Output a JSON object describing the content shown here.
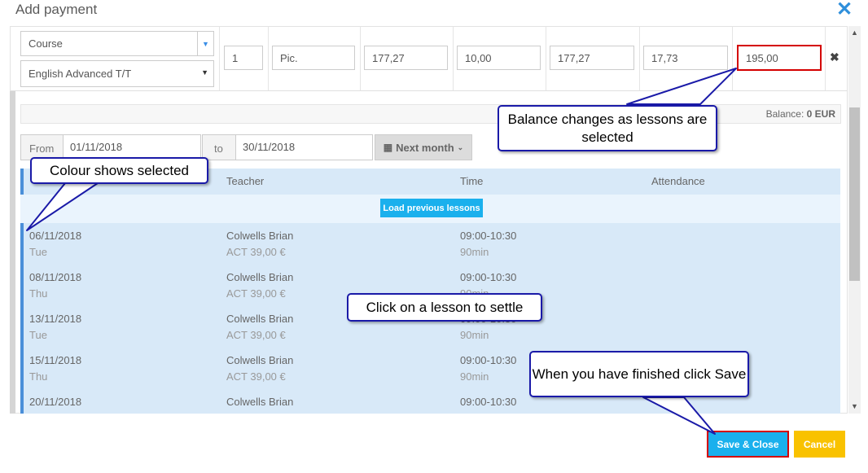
{
  "dialog": {
    "title": "Add payment"
  },
  "row": {
    "type_value": "Course",
    "course_value": "English Advanced T/T",
    "quantity": "1",
    "unit": "Pic.",
    "price": "177,27",
    "vat_percent": "10,00",
    "net": "177,27",
    "vat_amount": "17,73",
    "total": "195,00"
  },
  "balance": {
    "label": "Balance:",
    "value": "0 EUR"
  },
  "filter": {
    "from_label": "From",
    "from_value": "01/11/2018",
    "to_label": "to",
    "to_value": "30/11/2018",
    "next_month_label": "Next month"
  },
  "table": {
    "columns": [
      "Teacher",
      "Time",
      "Attendance"
    ],
    "load_previous_label": "Load previous lessons",
    "lessons": [
      {
        "date": "06/11/2018",
        "day": "Tue",
        "teacher": "Colwells Brian",
        "act": "ACT 39,00 €",
        "time": "09:00-10:30",
        "duration": "90min"
      },
      {
        "date": "08/11/2018",
        "day": "Thu",
        "teacher": "Colwells Brian",
        "act": "ACT 39,00 €",
        "time": "09:00-10:30",
        "duration": "90min"
      },
      {
        "date": "13/11/2018",
        "day": "Tue",
        "teacher": "Colwells Brian",
        "act": "ACT 39,00 €",
        "time": "09:00-10:30",
        "duration": "90min"
      },
      {
        "date": "15/11/2018",
        "day": "Thu",
        "teacher": "Colwells Brian",
        "act": "ACT 39,00 €",
        "time": "09:00-10:30",
        "duration": "90min"
      },
      {
        "date": "20/11/2018",
        "day": "",
        "teacher": "Colwells Brian",
        "act": "",
        "time": "09:00-10:30",
        "duration": ""
      }
    ]
  },
  "footer": {
    "save_label": "Save & Close",
    "cancel_label": "Cancel"
  },
  "callouts": {
    "balance": "Balance changes as lessons are selected",
    "colour": "Colour shows selected",
    "click_lesson": "Click on a lesson to settle",
    "finish": "When you have finished click Save"
  },
  "colors": {
    "accent": "#1ab0ed",
    "cancel": "#f9c200",
    "selected_row": "#d8e9f8",
    "highlight": "#d40000",
    "callout_border": "#1a1aa8"
  }
}
